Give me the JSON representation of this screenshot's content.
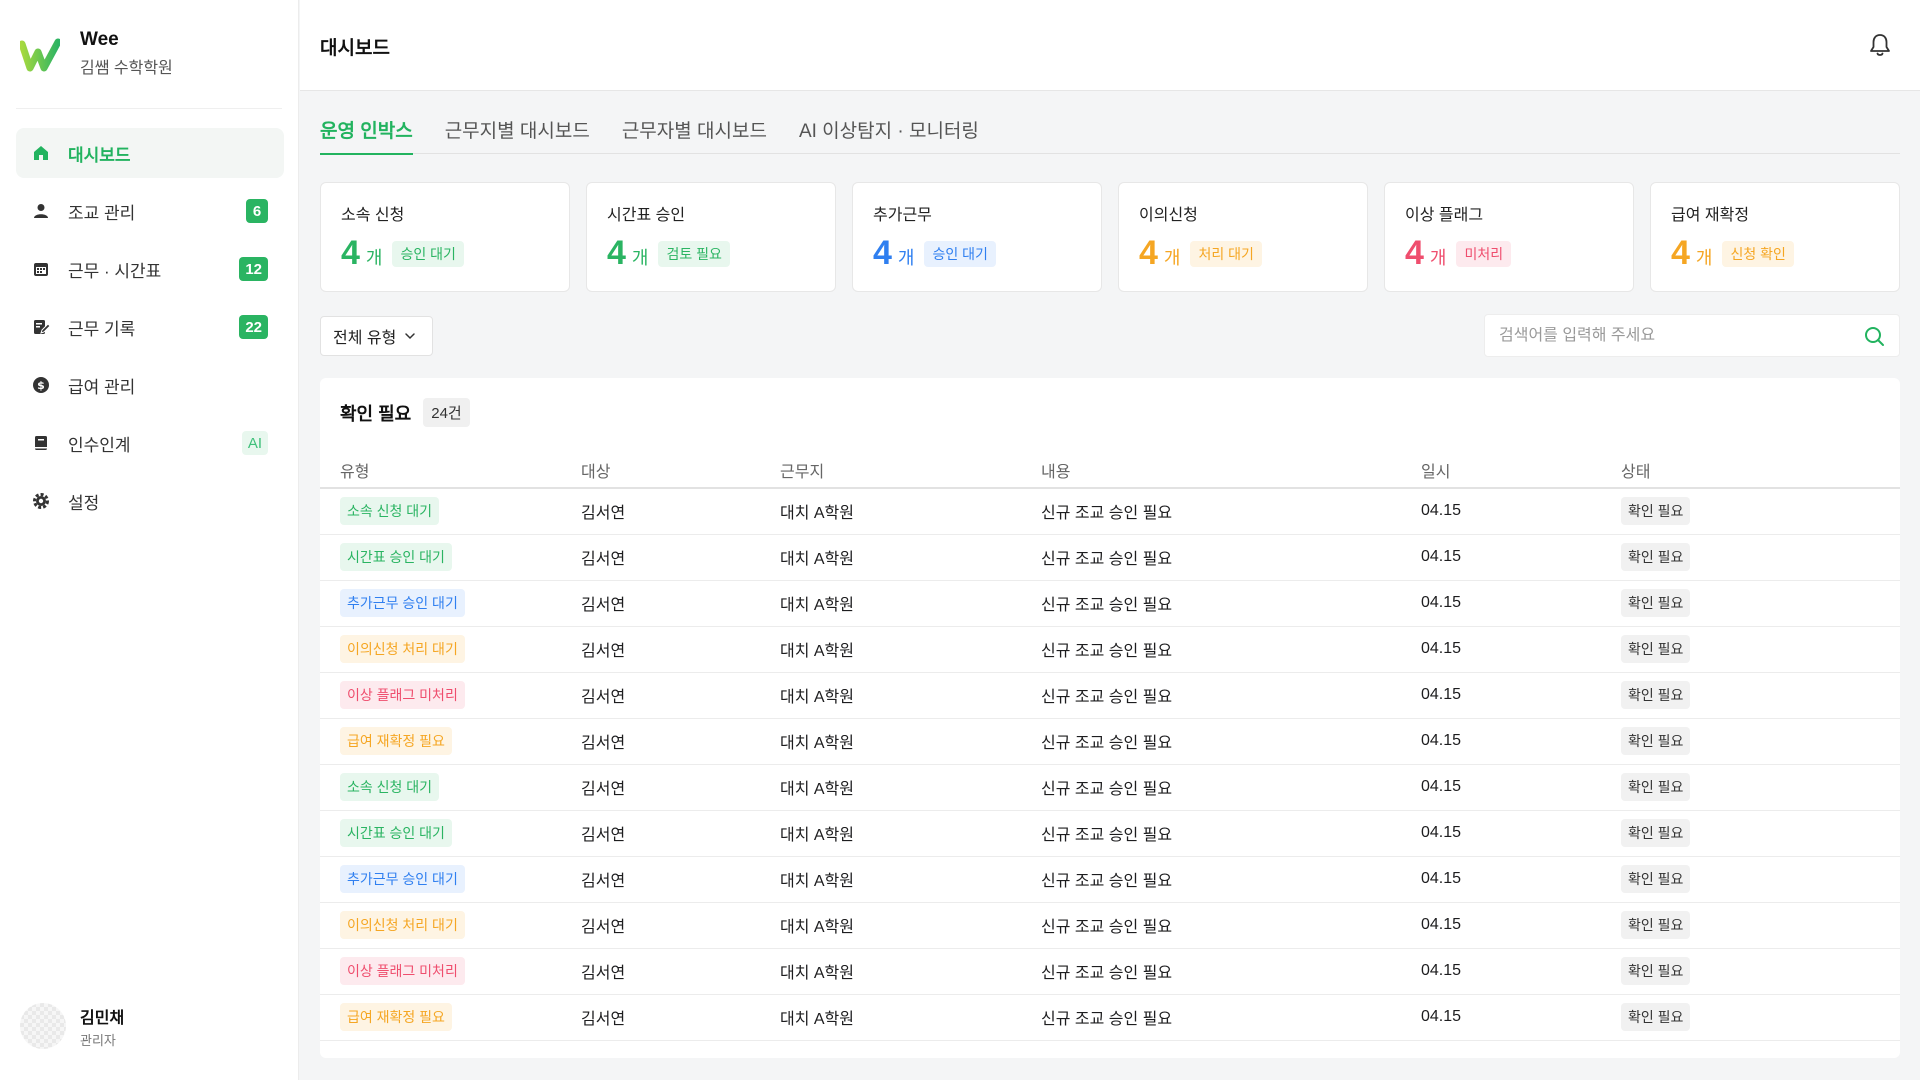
{
  "brand": {
    "name": "Wee",
    "subtitle": "김쌤 수학학원"
  },
  "sidebar": {
    "items": [
      {
        "label": "대시보드",
        "icon": "home-icon",
        "badge": null,
        "active": true
      },
      {
        "label": "조교 관리",
        "icon": "person-icon",
        "badge": "6"
      },
      {
        "label": "근무 · 시간표",
        "icon": "calendar-icon",
        "badge": "12"
      },
      {
        "label": "근무 기록",
        "icon": "edit-doc-icon",
        "badge": "22"
      },
      {
        "label": "급여 관리",
        "icon": "dollar-icon",
        "badge": null
      },
      {
        "label": "인수인계",
        "icon": "book-icon",
        "badge": "AI"
      },
      {
        "label": "설정",
        "icon": "gear-icon",
        "badge": null
      }
    ]
  },
  "user": {
    "name": "김민채",
    "role": "관리자"
  },
  "header": {
    "title": "대시보드",
    "icon": "bell-icon"
  },
  "tabs": [
    "운영 인박스",
    "근무지별 대시보드",
    "근무자별 대시보드",
    "AI 이상탐지 · 모니터링"
  ],
  "cards": [
    {
      "title": "소속 신청",
      "count": "4",
      "unit": "개",
      "tag": "승인 대기",
      "color": "#2ab462",
      "tag_bg": "#e8f7ee"
    },
    {
      "title": "시간표 승인",
      "count": "4",
      "unit": "개",
      "tag": "검토 필요",
      "color": "#2ab462",
      "tag_bg": "#e8f7ee"
    },
    {
      "title": "추가근무",
      "count": "4",
      "unit": "개",
      "tag": "승인 대기",
      "color": "#2f7ff0",
      "tag_bg": "#e8f1fe"
    },
    {
      "title": "이의신청",
      "count": "4",
      "unit": "개",
      "tag": "처리 대기",
      "color": "#f5a623",
      "tag_bg": "#fef4e3"
    },
    {
      "title": "이상 플래그",
      "count": "4",
      "unit": "개",
      "tag": "미처리",
      "color": "#ef4e6e",
      "tag_bg": "#fdeaee"
    },
    {
      "title": "급여 재확정",
      "count": "4",
      "unit": "개",
      "tag": "신청 확인",
      "color": "#f5a623",
      "tag_bg": "#fef4e3"
    }
  ],
  "filter": {
    "label": "전체 유형"
  },
  "search": {
    "placeholder": "검색어를 입력해 주세요"
  },
  "panel": {
    "title": "확인 필요",
    "count": "24건",
    "columns": [
      "유형",
      "대상",
      "근무지",
      "내용",
      "일시",
      "상태"
    ],
    "rows": [
      {
        "type": "소속 신청 대기",
        "kind": "green",
        "target": "김서연",
        "place": "대치 A학원",
        "content": "신규 조교 승인 필요",
        "date": "04.15",
        "status": "확인 필요"
      },
      {
        "type": "시간표 승인 대기",
        "kind": "green",
        "target": "김서연",
        "place": "대치 A학원",
        "content": "신규 조교 승인 필요",
        "date": "04.15",
        "status": "확인 필요"
      },
      {
        "type": "추가근무 승인 대기",
        "kind": "blue",
        "target": "김서연",
        "place": "대치 A학원",
        "content": "신규 조교 승인 필요",
        "date": "04.15",
        "status": "확인 필요"
      },
      {
        "type": "이의신청 처리 대기",
        "kind": "orange",
        "target": "김서연",
        "place": "대치 A학원",
        "content": "신규 조교 승인 필요",
        "date": "04.15",
        "status": "확인 필요"
      },
      {
        "type": "이상 플래그 미처리",
        "kind": "pink",
        "target": "김서연",
        "place": "대치 A학원",
        "content": "신규 조교 승인 필요",
        "date": "04.15",
        "status": "확인 필요"
      },
      {
        "type": "급여 재확정 필요",
        "kind": "orange",
        "target": "김서연",
        "place": "대치 A학원",
        "content": "신규 조교 승인 필요",
        "date": "04.15",
        "status": "확인 필요"
      },
      {
        "type": "소속 신청 대기",
        "kind": "green",
        "target": "김서연",
        "place": "대치 A학원",
        "content": "신규 조교 승인 필요",
        "date": "04.15",
        "status": "확인 필요"
      },
      {
        "type": "시간표 승인 대기",
        "kind": "green",
        "target": "김서연",
        "place": "대치 A학원",
        "content": "신규 조교 승인 필요",
        "date": "04.15",
        "status": "확인 필요"
      },
      {
        "type": "추가근무 승인 대기",
        "kind": "blue",
        "target": "김서연",
        "place": "대치 A학원",
        "content": "신규 조교 승인 필요",
        "date": "04.15",
        "status": "확인 필요"
      },
      {
        "type": "이의신청 처리 대기",
        "kind": "orange",
        "target": "김서연",
        "place": "대치 A학원",
        "content": "신규 조교 승인 필요",
        "date": "04.15",
        "status": "확인 필요"
      },
      {
        "type": "이상 플래그 미처리",
        "kind": "pink",
        "target": "김서연",
        "place": "대치 A학원",
        "content": "신규 조교 승인 필요",
        "date": "04.15",
        "status": "확인 필요"
      },
      {
        "type": "급여 재확정 필요",
        "kind": "orange",
        "target": "김서연",
        "place": "대치 A학원",
        "content": "신규 조교 승인 필요",
        "date": "04.15",
        "status": "확인 필요"
      }
    ]
  },
  "colors": {
    "accent": "#22b35f",
    "green": {
      "fg": "#2ab462",
      "bg": "#e8f7ee"
    },
    "blue": {
      "fg": "#2f7ff0",
      "bg": "#e8f1fe"
    },
    "orange": {
      "fg": "#f5a623",
      "bg": "#fef4e3"
    },
    "pink": {
      "fg": "#ef4e6e",
      "bg": "#fdeaee"
    }
  }
}
